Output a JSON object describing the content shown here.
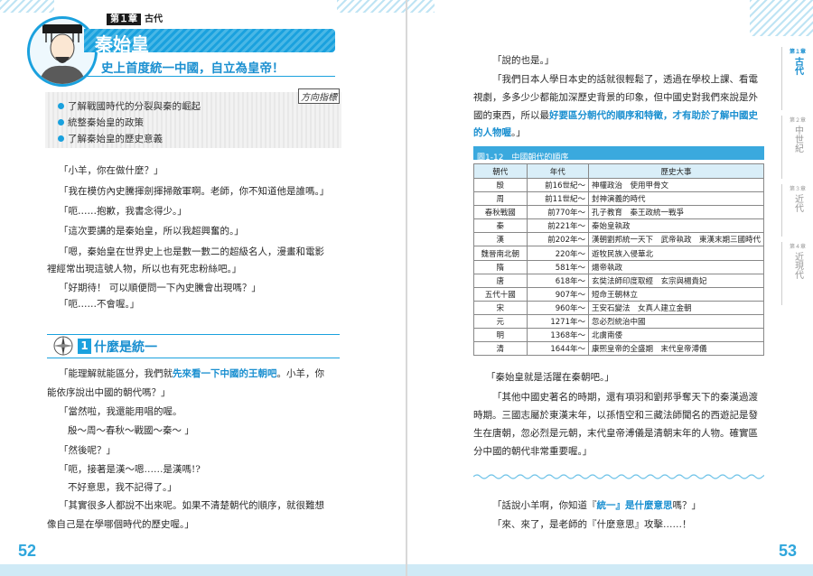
{
  "left": {
    "chapter_no": "第１章",
    "chapter_name": "古代",
    "title": "秦始皇",
    "subtitle": "史上首度統一中國，自立為皇帝！",
    "directive_label": "方向指標",
    "goals": [
      "了解戰國時代的分裂與秦的崛起",
      "統整秦始皇的政策",
      "了解秦始皇的歷史意義"
    ],
    "dialog1": [
      "「小羊，你在做什麼？」",
      "「我在模仿內史騰揮劍揮掃敵軍啊。老師，你不知道他是誰嗎。」",
      "「呃……抱歉，我書念得少。」",
      "「這次要講的是秦始皇，所以我超興奮的。」",
      "「嗯，秦始皇在世界史上也是數一數二的超級名人，漫畫和電影",
      "裡經常出現這號人物，所以也有死忠粉絲吧。」",
      "「好期待！ 可以順便問一下內史騰會出現嗎？」",
      "「呃……不會喔。」"
    ],
    "section_no": "1",
    "section_title": "什麼是統一",
    "dialog2_p1_pre": "「能理解就能區分，我們就",
    "dialog2_p1_hl": "先來看一下中國的王朝吧",
    "dialog2_p1_post": "。小羊，你",
    "dialog2": [
      "能依序說出中國的朝代嗎？」",
      "「當然啦，我還能用唱的喔。",
      "殷～周～春秋～戰國～秦～ 」",
      "「然後呢？」",
      "「呃，接著是漢～嗯……是漢嗎!?",
      "不好意思，我不記得了。」",
      "「其實很多人都說不出來呢。如果不清楚朝代的順序，就很難想",
      "像自己是在學哪個時代的歷史喔。」"
    ],
    "page_number": "52"
  },
  "right": {
    "para1": "「說的也是。」",
    "para2_l1": "「我們日本人學日本史的話就很輕鬆了，透過在學校上課、看電",
    "para2_l2": "視劇，多多少少都能加深歷史背景的印象，但中國史對我們來說是外",
    "para2_l3_pre": "國的東西，所以最",
    "para2_l3_hl": "好要區分朝代的順序和特徵，才有助於了解中國史",
    "para2_l4_hl": "的人物喔",
    "para2_l4_post": "。」",
    "figure_caption": "圖1-12　中國朝代的順序",
    "table_headers": [
      "朝代",
      "年代",
      "歷史大事"
    ],
    "table_rows": [
      [
        "殷",
        "前16世紀～",
        "神權政治　使用甲骨文"
      ],
      [
        "周",
        "前11世紀～",
        "封神演義的時代"
      ],
      [
        "春秋戰國",
        "前770年～",
        "孔子教育　秦王政統一戰爭"
      ],
      [
        "秦",
        "前221年～",
        "秦始皇執政"
      ],
      [
        "漢",
        "前202年～",
        "漢朝劉邦統一天下　武帝執政　東漢末期三國時代"
      ],
      [
        "魏晉南北朝",
        "220年～",
        "遊牧民族入侵華北"
      ],
      [
        "隋",
        "581年～",
        "煬帝執政"
      ],
      [
        "唐",
        "618年～",
        "玄奘法師印度取經　玄宗與楊貴妃"
      ],
      [
        "五代十國",
        "907年～",
        "短命王朝林立"
      ],
      [
        "宋",
        "960年～",
        "王安石變法　女真人建立金朝"
      ],
      [
        "元",
        "1271年～",
        "忽必烈統治中國"
      ],
      [
        "明",
        "1368年～",
        "北虜南倭"
      ],
      [
        "清",
        "1644年～",
        "康熙皇帝的全盛期　末代皇帝溥儀"
      ]
    ],
    "para3": [
      "「秦始皇就是活躍在秦朝吧。」",
      "「其他中國史著名的時期，還有項羽和劉邦爭奪天下的秦漢過渡",
      "時期。三國志屬於東漢末年，以孫悟空和三藏法師聞名的西遊記是發",
      "生在唐朝，忽必烈是元朝，末代皇帝溥儀是清朝末年的人物。確實區",
      "分中國的朝代非常重要喔。」"
    ],
    "para4_pre": "「話說小羊啊，你知道『",
    "para4_hl": "統一』是什麼意思",
    "para4_post": "嗎？」",
    "para5": "「來、來了，是老師的『什麼意思』攻擊……！",
    "page_number": "53"
  },
  "side_tabs": [
    {
      "no": "第１章",
      "label": "古代",
      "active": true
    },
    {
      "no": "第２章",
      "label": "中世紀",
      "active": false
    },
    {
      "no": "第３章",
      "label": "近代",
      "active": false
    },
    {
      "no": "第４章",
      "label": "近現代",
      "active": false
    }
  ],
  "colors": {
    "accent": "#1aa1de",
    "highlight": "#1a8fd0",
    "table_header": "#d9eef8"
  }
}
